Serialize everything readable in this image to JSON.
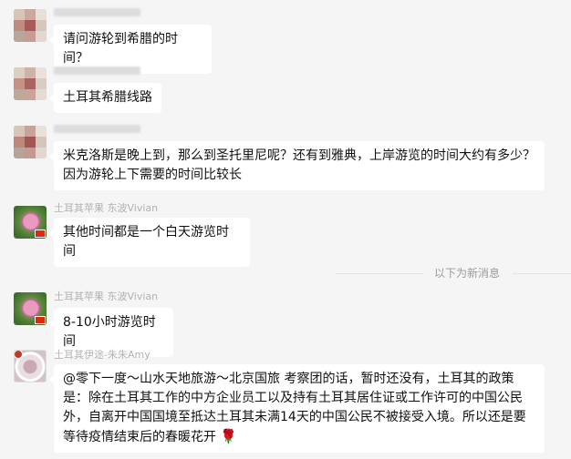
{
  "messages": [
    {
      "sender_name": "",
      "text": "请问游轮到希腊的时间？"
    },
    {
      "sender_name": "",
      "text": "土耳其希腊线路"
    },
    {
      "sender_name": "",
      "text": "米克洛斯是晚上到，那么到圣托里尼呢？还有到雅典，上岸游览的时间大约有多少？因为游轮上下需要的时间比较长"
    },
    {
      "sender_name": "土耳其苹果 东波Vivian",
      "text": "其他时间都是一个白天游览时间"
    },
    {
      "sender_name": "土耳其苹果 东波Vivian",
      "text": "8-10小时游览时间"
    },
    {
      "sender_name": "土耳其伊途-朱朱Amy",
      "text": "@零下一度～山水天地旅游～北京国旅 考察团的话，暂时还没有，土耳其的政策是：除在土耳其工作的中方企业员工以及持有土耳其居住证或工作许可的中国公民外，自离开中国国境至抵达土耳其未满14天的中国公民不被接受入境。所以还是要等待疫情结束后的春暖花开"
    }
  ],
  "divider": {
    "label": "以下为新消息"
  },
  "icons": {
    "rose": "rose-icon",
    "flag": "china-flag-icon"
  }
}
